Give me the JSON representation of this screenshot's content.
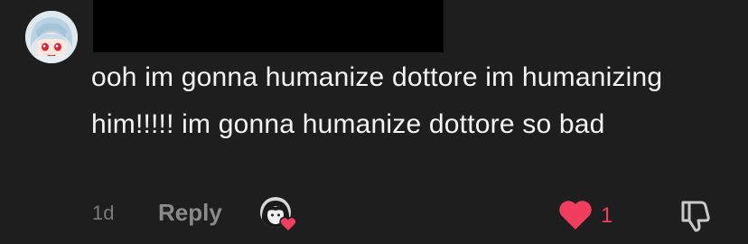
{
  "comment": {
    "text": "ooh im gonna humanize dottore im humanizing him!!!!! im gonna humanize dottore so bad",
    "time": "1d",
    "reply_label": "Reply",
    "like_count": "1",
    "liked": true
  },
  "colors": {
    "background": "#1e1e1e",
    "text": "#f4f4f4",
    "muted": "#7a7a7a",
    "like": "#f23e5e"
  },
  "icons": {
    "avatar": "anime-character-avatar",
    "creator_avatar": "creator-avatar",
    "creator_heart": "heart-icon",
    "like": "heart-icon",
    "dislike": "thumbs-down-icon"
  }
}
